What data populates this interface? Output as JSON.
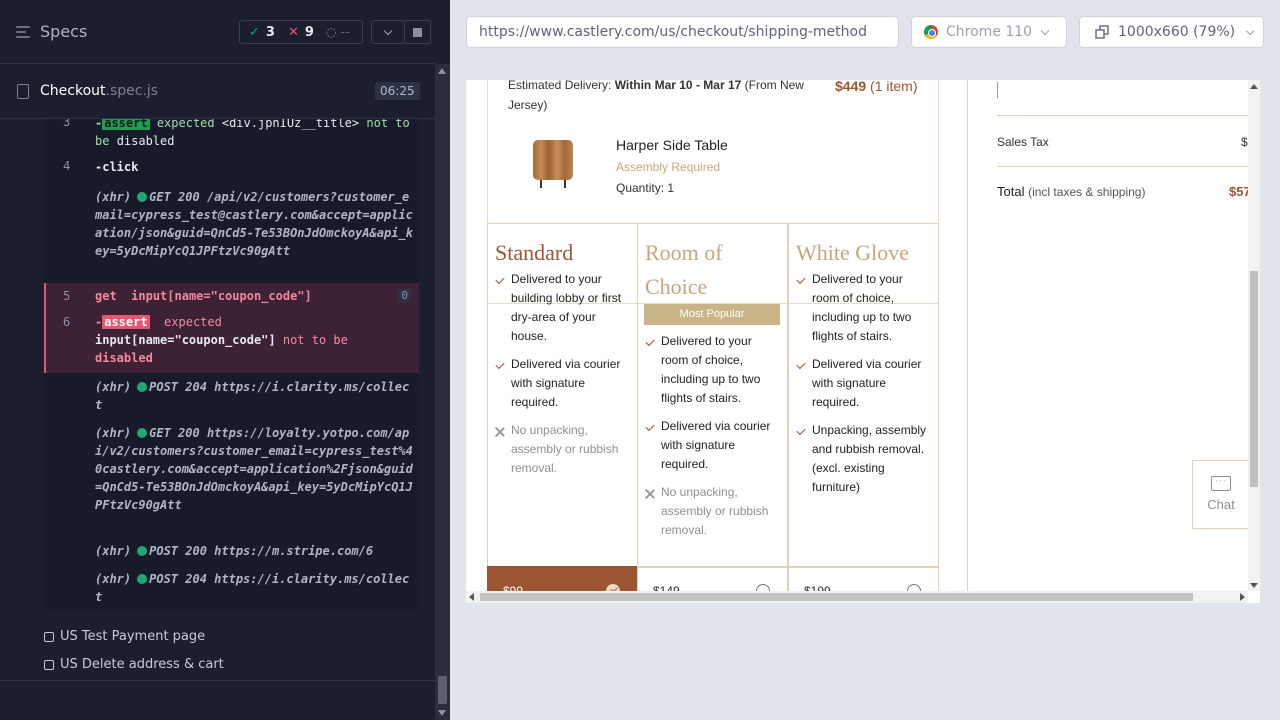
{
  "runner": {
    "title": "Specs",
    "stats": {
      "passed": "3",
      "failed": "9",
      "pending": "--"
    },
    "spec_name": "Checkout",
    "spec_ext": ".spec.js",
    "duration": "06:25",
    "commands": [
      {
        "num": "3",
        "prefix": "-",
        "badge": "assert",
        "text": "expected",
        "arg": "<div.jpnIUz__title>",
        "rest": "not to be",
        "tail": "disabled"
      },
      {
        "num": "4",
        "text": "-click"
      },
      {
        "xhr": "(xhr)",
        "method": "GET 200",
        "url": "/api/v2/customers?customer_email=cypress_test@castlery.com&accept=application/json&guid=QnCd5-Te53BOnJdOmckoyA&api_key=5yDcMipYcQ1JPFtzVc90gAtt"
      },
      {
        "num": "5",
        "cmd": "get",
        "arg": "input[name=\"coupon_code\"]",
        "count": "0"
      },
      {
        "num": "6",
        "prefix": "-",
        "badge": "assert",
        "text": "expected",
        "arg": "input[name=\"coupon_code\"]",
        "rest": "not to be",
        "tail": "disabled"
      },
      {
        "xhr": "(xhr)",
        "method": "POST 204",
        "url": "https://i.clarity.ms/collect"
      },
      {
        "xhr": "(xhr)",
        "method": "GET 200",
        "url": "https://loyalty.yotpo.com/api/v2/customers?customer_email=cypress_test%40castlery.com&accept=application%2Fjson&guid=QnCd5-Te53BOnJdOmckoyA&api_key=5yDcMipYcQ1JPFtzVc90gAtt"
      },
      {
        "xhr": "(xhr)",
        "method": "POST 200",
        "url": "https://m.stripe.com/6"
      },
      {
        "xhr": "(xhr)",
        "method": "POST 204",
        "url": "https://i.clarity.ms/collect"
      }
    ],
    "suites": [
      "US Test Payment page",
      "US Delete address & cart"
    ]
  },
  "browser": {
    "url": "https://www.castlery.com/us/checkout/shipping-method",
    "browser_name": "Chrome 110",
    "viewport": "1000x660 (79%)"
  },
  "page": {
    "estimated_prefix": "Estimated Delivery: ",
    "estimated_bold": "Within Mar 10 - Mar 17",
    "estimated_suffix": " (From New Jersey)",
    "order_price": "$449",
    "order_items": "(1 item)",
    "product": {
      "name": "Harper Side Table",
      "assembly": "Assembly Required",
      "quantity": "Quantity: 1"
    },
    "options": [
      {
        "title": "Standard",
        "price": "$99",
        "selected": true,
        "features": [
          {
            "text": "Delivered to your building lobby or first dry-area of your house.",
            "included": true
          },
          {
            "text": "Delivered via courier with signature required.",
            "included": true
          },
          {
            "text": "No unpacking, assembly or rubbish removal.",
            "included": false
          }
        ]
      },
      {
        "title": "Room of Choice",
        "badge": "Most Popular",
        "price": "$149",
        "selected": false,
        "features": [
          {
            "text": "Delivered to your room of choice, including up to two flights of stairs.",
            "included": true
          },
          {
            "text": "Delivered via courier with signature required.",
            "included": true
          },
          {
            "text": "No unpacking, assembly or rubbish removal.",
            "included": false
          }
        ]
      },
      {
        "title": "White Glove",
        "price": "$199",
        "selected": false,
        "features": [
          {
            "text": "Delivered to your room of choice, including up to two flights of stairs.",
            "included": true
          },
          {
            "text": "Delivered via courier with signature required.",
            "included": true
          },
          {
            "text": "Unpacking, assembly and rubbish removal. (excl. existing furniture)",
            "included": true
          }
        ]
      }
    ],
    "summary": {
      "sales_tax_label": "Sales Tax",
      "sales_tax_value": "$",
      "total_label": "Total",
      "total_note": "(incl taxes & shipping)",
      "total_value": "$57"
    },
    "chat_label": "Chat"
  }
}
